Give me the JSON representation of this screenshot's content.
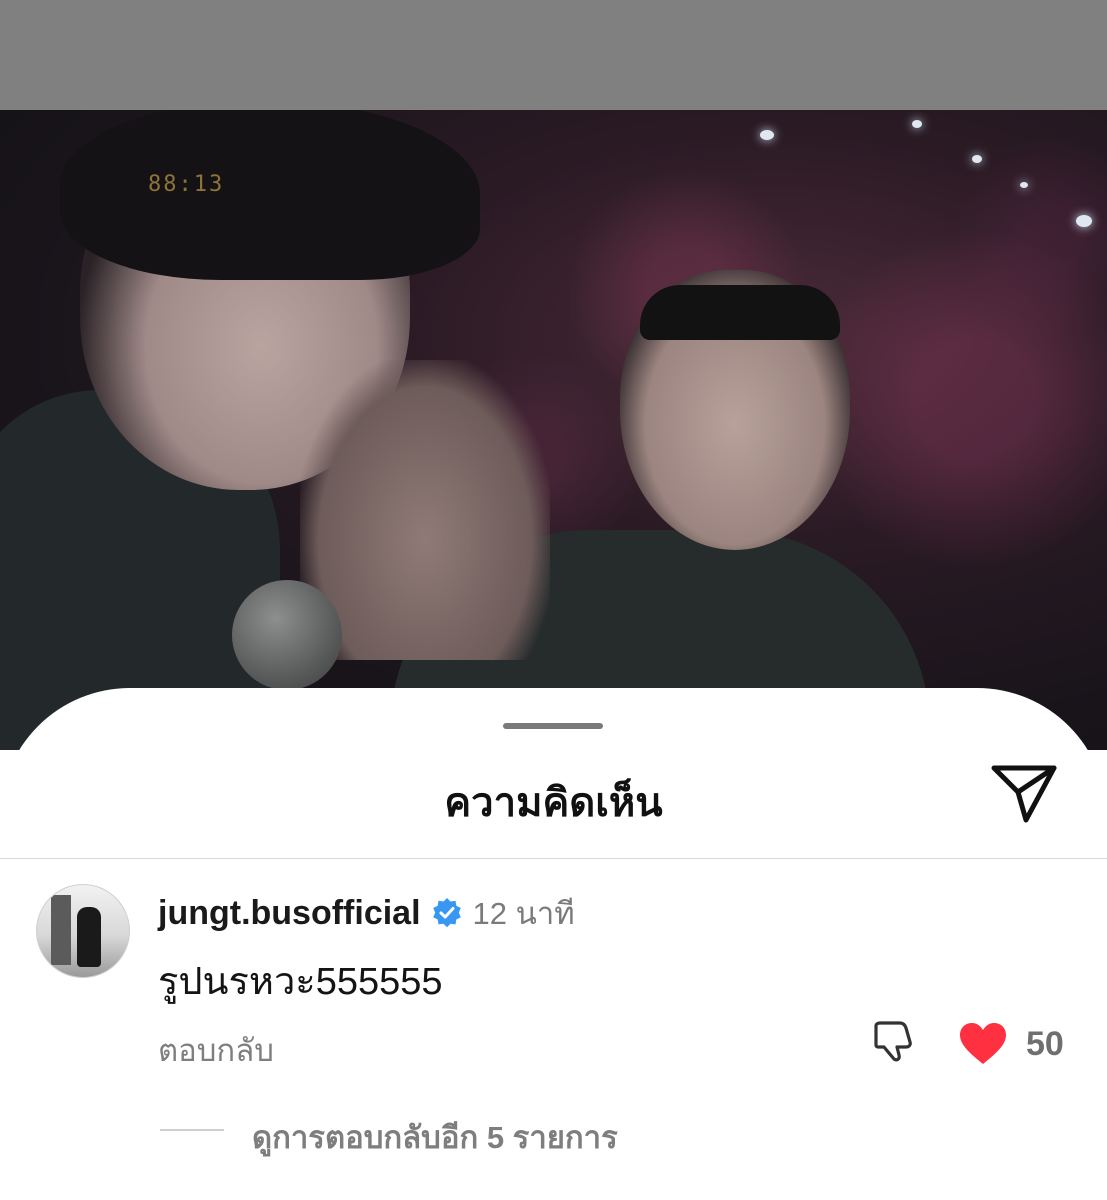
{
  "photo": {
    "timestamp_overlay": "88:13"
  },
  "sheet": {
    "title": "ความคิดเห็น",
    "share_icon": "paper-plane-icon"
  },
  "comment": {
    "username": "jungt.busofficial",
    "verified_icon": "verified-badge-icon",
    "time": "12 นาที",
    "text": "รูปนรหวะ555555",
    "reply_label": "ตอบกลับ",
    "dislike_icon": "thumbs-down-icon",
    "like_icon": "heart-icon",
    "like_count": "50",
    "view_more_replies": "ดูการตอบกลับอีก 5 รายการ"
  },
  "colors": {
    "like_red": "#ff3040",
    "verified_blue": "#3897f0",
    "dim_overlay": "#808080"
  }
}
